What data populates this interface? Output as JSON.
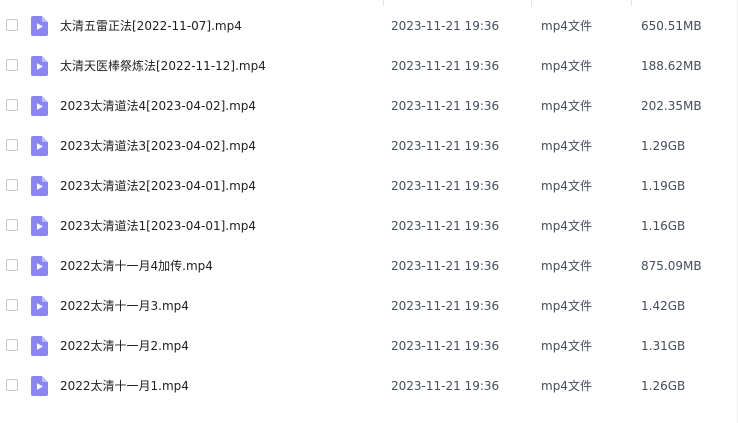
{
  "file_icon": "video-file-icon",
  "accent_color": "#8b85f0",
  "files": [
    {
      "name": "太清五雷正法[2022-11-07].mp4",
      "modified": "2023-11-21 19:36",
      "type": "mp4文件",
      "size": "650.51MB"
    },
    {
      "name": "太清天医棒祭炼法[2022-11-12].mp4",
      "modified": "2023-11-21 19:36",
      "type": "mp4文件",
      "size": "188.62MB"
    },
    {
      "name": "2023太清道法4[2023-04-02].mp4",
      "modified": "2023-11-21 19:36",
      "type": "mp4文件",
      "size": "202.35MB"
    },
    {
      "name": "2023太清道法3[2023-04-02].mp4",
      "modified": "2023-11-21 19:36",
      "type": "mp4文件",
      "size": "1.29GB"
    },
    {
      "name": "2023太清道法2[2023-04-01].mp4",
      "modified": "2023-11-21 19:36",
      "type": "mp4文件",
      "size": "1.19GB"
    },
    {
      "name": "2023太清道法1[2023-04-01].mp4",
      "modified": "2023-11-21 19:36",
      "type": "mp4文件",
      "size": "1.16GB"
    },
    {
      "name": "2022太清十一月4加传.mp4",
      "modified": "2023-11-21 19:36",
      "type": "mp4文件",
      "size": "875.09MB"
    },
    {
      "name": "2022太清十一月3.mp4",
      "modified": "2023-11-21 19:36",
      "type": "mp4文件",
      "size": "1.42GB"
    },
    {
      "name": "2022太清十一月2.mp4",
      "modified": "2023-11-21 19:36",
      "type": "mp4文件",
      "size": "1.31GB"
    },
    {
      "name": "2022太清十一月1.mp4",
      "modified": "2023-11-21 19:36",
      "type": "mp4文件",
      "size": "1.26GB"
    }
  ]
}
